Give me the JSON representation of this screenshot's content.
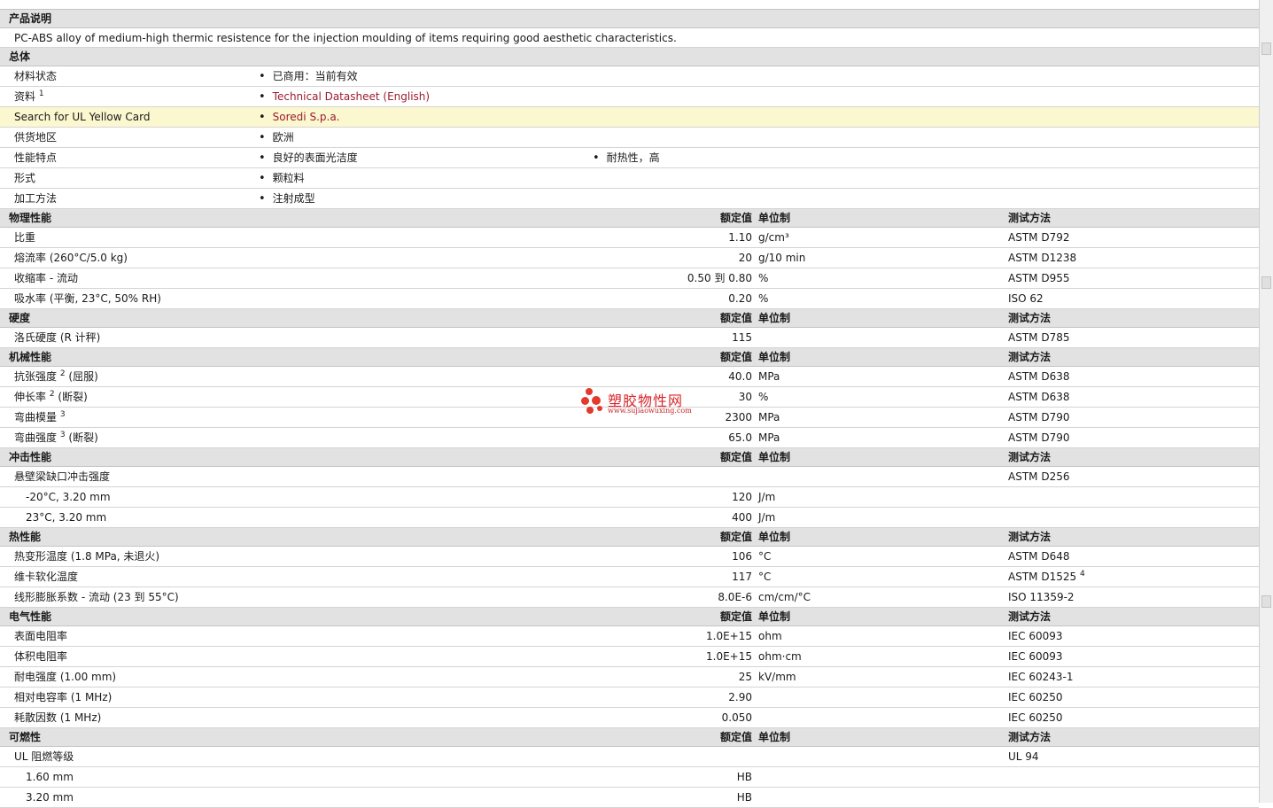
{
  "description": {
    "title": "产品说明",
    "text": "PC-ABS alloy of medium-high thermic resistence for the injection moulding of items requiring good aesthetic characteristics."
  },
  "general": {
    "title": "总体",
    "rows": [
      {
        "label": "材料状态",
        "v1": "已商用：当前有效"
      },
      {
        "label": "资料",
        "sup": "1",
        "v1": "Technical Datasheet (English)"
      },
      {
        "label": "Search for UL Yellow Card",
        "v1": "Soredi S.p.a."
      },
      {
        "label": "供货地区",
        "v1": "欧洲"
      },
      {
        "label": "性能特点",
        "v1": "良好的表面光洁度",
        "v2": "耐热性，高"
      },
      {
        "label": "形式",
        "v1": "颗粒料"
      },
      {
        "label": "加工方法",
        "v1": "注射成型"
      }
    ]
  },
  "columns": {
    "nominal": "额定值",
    "unit": "单位制",
    "test": "测试方法"
  },
  "sections": {
    "physical": {
      "title": "物理性能",
      "rows": [
        {
          "label": "比重",
          "nominal": "1.10",
          "unit": "g/cm³",
          "test": "ASTM D792"
        },
        {
          "label": "熔流率 (260°C/5.0 kg)",
          "nominal": "20",
          "unit": "g/10 min",
          "test": "ASTM D1238"
        },
        {
          "label": "收缩率 - 流动",
          "nominal": "0.50 到  0.80",
          "unit": "%",
          "test": "ASTM D955"
        },
        {
          "label": "吸水率 (平衡, 23°C, 50% RH)",
          "nominal": "0.20",
          "unit": "%",
          "test": "ISO 62"
        }
      ]
    },
    "hardness": {
      "title": "硬度",
      "rows": [
        {
          "label": "洛氏硬度 (R 计秤)",
          "nominal": "115",
          "unit": "",
          "test": "ASTM D785"
        }
      ]
    },
    "mechanical": {
      "title": "机械性能",
      "rows": [
        {
          "label": "抗张强度",
          "sup": "2",
          "suffix": " (屈服)",
          "nominal": "40.0",
          "unit": "MPa",
          "test": "ASTM D638"
        },
        {
          "label": "伸长率",
          "sup": "2",
          "suffix": " (断裂)",
          "nominal": "30",
          "unit": "%",
          "test": "ASTM D638"
        },
        {
          "label": "弯曲模量",
          "sup": "3",
          "suffix": "",
          "nominal": "2300",
          "unit": "MPa",
          "test": "ASTM D790"
        },
        {
          "label": "弯曲强度",
          "sup": "3",
          "suffix": " (断裂)",
          "nominal": "65.0",
          "unit": "MPa",
          "test": "ASTM D790"
        }
      ]
    },
    "impact": {
      "title": "冲击性能",
      "rows": [
        {
          "label": "悬壁梁缺口冲击强度",
          "nominal": "",
          "unit": "",
          "test": "ASTM D256"
        },
        {
          "label": "-20°C, 3.20 mm",
          "nominal": "120",
          "unit": "J/m",
          "test": ""
        },
        {
          "label": "23°C, 3.20 mm",
          "nominal": "400",
          "unit": "J/m",
          "test": ""
        }
      ]
    },
    "thermal": {
      "title": "热性能",
      "rows": [
        {
          "label": "热变形温度 (1.8 MPa, 未退火)",
          "nominal": "106",
          "unit": "°C",
          "test": "ASTM D648"
        },
        {
          "label": "维卡软化温度",
          "nominal": "117",
          "unit": "°C",
          "test": "ASTM D1525",
          "test_sup": "4"
        },
        {
          "label": "线形膨胀系数 - 流动 (23 到  55°C)",
          "nominal": "8.0E-6",
          "unit": "cm/cm/°C",
          "test": "ISO 11359-2"
        }
      ]
    },
    "electrical": {
      "title": "电气性能",
      "rows": [
        {
          "label": "表面电阻率",
          "nominal": "1.0E+15",
          "unit": "ohm",
          "test": "IEC 60093"
        },
        {
          "label": "体积电阻率",
          "nominal": "1.0E+15",
          "unit": "ohm·cm",
          "test": "IEC 60093"
        },
        {
          "label": "耐电强度 (1.00 mm)",
          "nominal": "25",
          "unit": "kV/mm",
          "test": "IEC 60243-1"
        },
        {
          "label": "相对电容率 (1 MHz)",
          "nominal": "2.90",
          "unit": "",
          "test": "IEC 60250"
        },
        {
          "label": "耗散因数 (1 MHz)",
          "nominal": "0.050",
          "unit": "",
          "test": "IEC 60250"
        }
      ]
    },
    "flammability": {
      "title": "可燃性",
      "rows": [
        {
          "label": "UL 阻燃等级",
          "nominal": "",
          "unit": "",
          "test": "UL 94"
        },
        {
          "label": "1.60 mm",
          "nominal": "HB",
          "unit": "",
          "test": ""
        },
        {
          "label": "3.20 mm",
          "nominal": "HB",
          "unit": "",
          "test": ""
        }
      ]
    }
  },
  "watermark": {
    "text": "塑胶物性网",
    "url": "www.sujiaowuxing.com"
  }
}
